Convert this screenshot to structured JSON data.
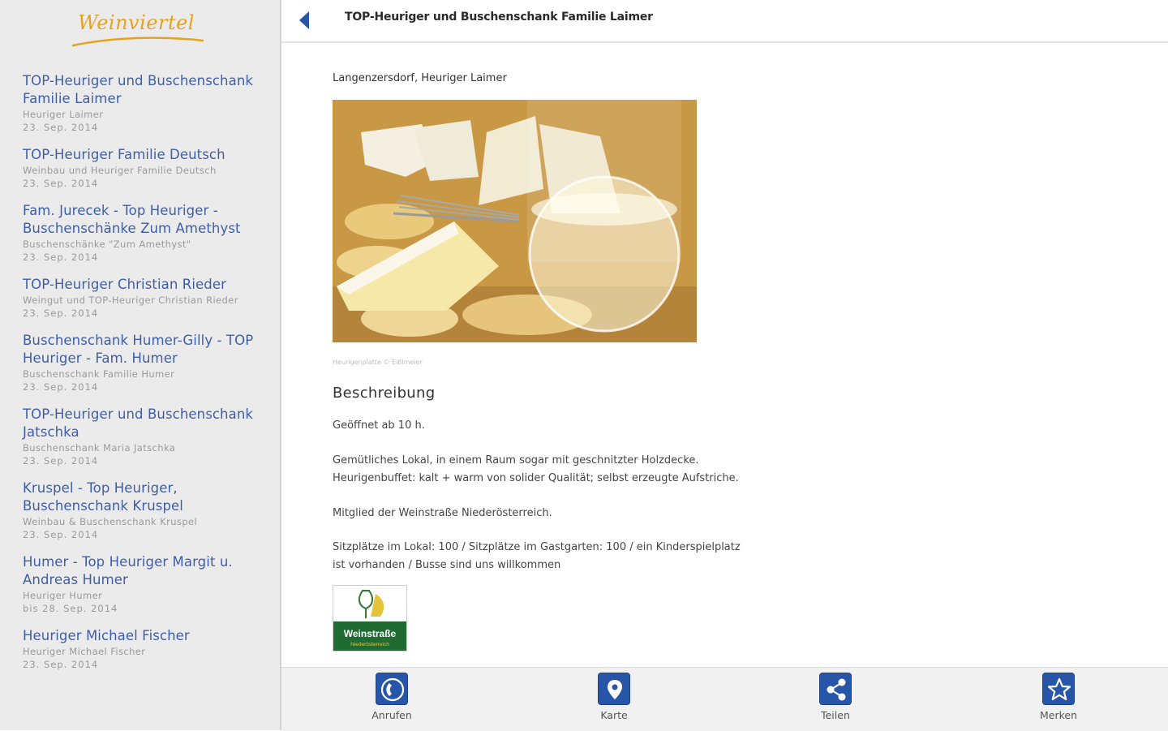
{
  "brand": {
    "logo_text": "Weinviertel"
  },
  "sidebar": {
    "items": [
      {
        "title": "TOP-Heuriger und Buschenschank Familie Laimer",
        "subtitle": "Heuriger Laimer",
        "date": "23. Sep. 2014"
      },
      {
        "title": "TOP-Heuriger Familie Deutsch",
        "subtitle": "Weinbau und Heuriger Familie Deutsch",
        "date": "23. Sep. 2014"
      },
      {
        "title": "Fam. Jurecek - Top Heuriger - Buschenschänke Zum Amethyst",
        "subtitle": "Buschenschänke \"Zum Amethyst\"",
        "date": "23. Sep. 2014"
      },
      {
        "title": "TOP-Heuriger Christian Rieder",
        "subtitle": "Weingut und TOP-Heuriger Christian Rieder",
        "date": "23. Sep. 2014"
      },
      {
        "title": "Buschenschank Humer-Gilly - TOP Heuriger - Fam. Humer",
        "subtitle": "Buschenschank Familie Humer",
        "date": "23. Sep. 2014"
      },
      {
        "title": "TOP-Heuriger und Buschenschank Jatschka",
        "subtitle": "Buschenschank Maria Jatschka",
        "date": "23. Sep. 2014"
      },
      {
        "title": "Kruspel - Top Heuriger, Buschenschank Kruspel",
        "subtitle": "Weinbau & Buschenschank Kruspel",
        "date": "23. Sep. 2014"
      },
      {
        "title": "Humer - Top Heuriger Margit u. Andreas Humer",
        "subtitle": "Heuriger Humer",
        "date": "bis 28. Sep. 2014"
      },
      {
        "title": "Heuriger Michael Fischer",
        "subtitle": "Heuriger Michael Fischer",
        "date": "23. Sep. 2014"
      }
    ]
  },
  "header": {
    "title": "TOP-Heuriger und Buschenschank Familie Laimer"
  },
  "detail": {
    "location": "Langenzersdorf, Heuriger Laimer",
    "photo_caption": "Heurigenplatte © Eißlmeier",
    "section_heading": "Beschreibung",
    "opening": "Geöffnet ab 10 h.",
    "description_1": "Gemütliches Lokal, in einem Raum sogar mit geschnitzter Holzdecke.",
    "description_2": "Heurigenbuffet: kalt + warm von solider Qualität; selbst erzeugte Aufstriche.",
    "membership": "Mitglied der Weinstraße Niederösterreich.",
    "seating_1": "Sitzplätze im Lokal: 100 / Sitzplätze im Gastgarten: 100 / ein Kinderspielplatz",
    "seating_2": "ist vorhanden / Busse sind uns willkommen",
    "badge_label": "Weinstraße",
    "badge_sublabel": "Niederösterreich"
  },
  "actions": [
    {
      "label": "Anrufen",
      "icon": "phone-icon"
    },
    {
      "label": "Karte",
      "icon": "map-pin-icon"
    },
    {
      "label": "Teilen",
      "icon": "share-icon"
    },
    {
      "label": "Merken",
      "icon": "star-icon"
    }
  ],
  "colors": {
    "link": "#3f5ea8",
    "accent": "#2755a8",
    "logo": "#e6a21f"
  }
}
